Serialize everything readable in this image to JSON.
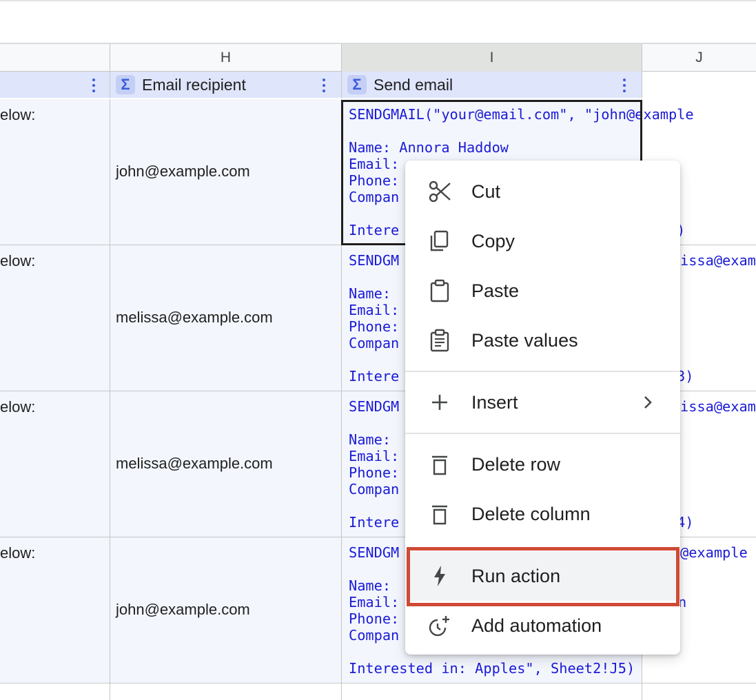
{
  "columns": {
    "h_letter": "H",
    "i_letter": "I",
    "j_letter": "J"
  },
  "headers": {
    "email_recipient": "Email recipient",
    "send_email": "Send email"
  },
  "rows": [
    {
      "left_fragment": "elow:",
      "recipient": "john@example.com",
      "formula_line1": "SENDGMAIL(\"your@email.com\", \"john@example",
      "formula_name": "Name: Annora Haddow",
      "formula_email": "Email: ",
      "formula_phone": "Phone:",
      "formula_company": "Compan",
      "formula_interest": "Intere",
      "formula_tail": ")"
    },
    {
      "left_fragment": "elow:",
      "recipient": "melissa@example.com",
      "formula_line1": "SENDGM",
      "spill_right": "issa@exam",
      "formula_name": "Name:",
      "formula_email": "Email:",
      "formula_phone": "Phone:",
      "formula_company": "Compan",
      "formula_interest": "Intere",
      "formula_tail": "3)"
    },
    {
      "left_fragment": "elow:",
      "recipient": "melissa@example.com",
      "formula_line1": "SENDGM",
      "spill_right": "issa@exam",
      "formula_name": "Name:",
      "formula_email": "Email:",
      "formula_phone": "Phone:",
      "formula_company": "Compan",
      "formula_interest": "Intere",
      "formula_tail": "4)"
    },
    {
      "left_fragment": "elow:",
      "recipient": "john@example.com",
      "formula_line1": "SENDGM",
      "spill_right": "@example",
      "formula_name": "Name:",
      "formula_email": "Email:",
      "formula_phone": "Phone:",
      "formula_company": "Compan",
      "formula_interest": "Interested in: Apples\", Sheet2!J5)",
      "formula_email_tail": "n"
    }
  ],
  "context_menu": {
    "cut": "Cut",
    "copy": "Copy",
    "paste": "Paste",
    "paste_values": "Paste values",
    "insert": "Insert",
    "delete_row": "Delete row",
    "delete_column": "Delete column",
    "run_action": "Run action",
    "add_automation": "Add automation"
  },
  "colors": {
    "formula_blue": "#1b1bd6",
    "header_bg": "#dfe5fb",
    "highlight_red": "#cf4a35"
  },
  "icons": [
    "scissors-icon",
    "copy-icon",
    "clipboard-icon",
    "paste-values-icon",
    "plus-icon",
    "chevron-right-icon",
    "trash-icon",
    "bolt-icon",
    "automation-clock-icon",
    "sigma-icon",
    "kebab-icon"
  ]
}
